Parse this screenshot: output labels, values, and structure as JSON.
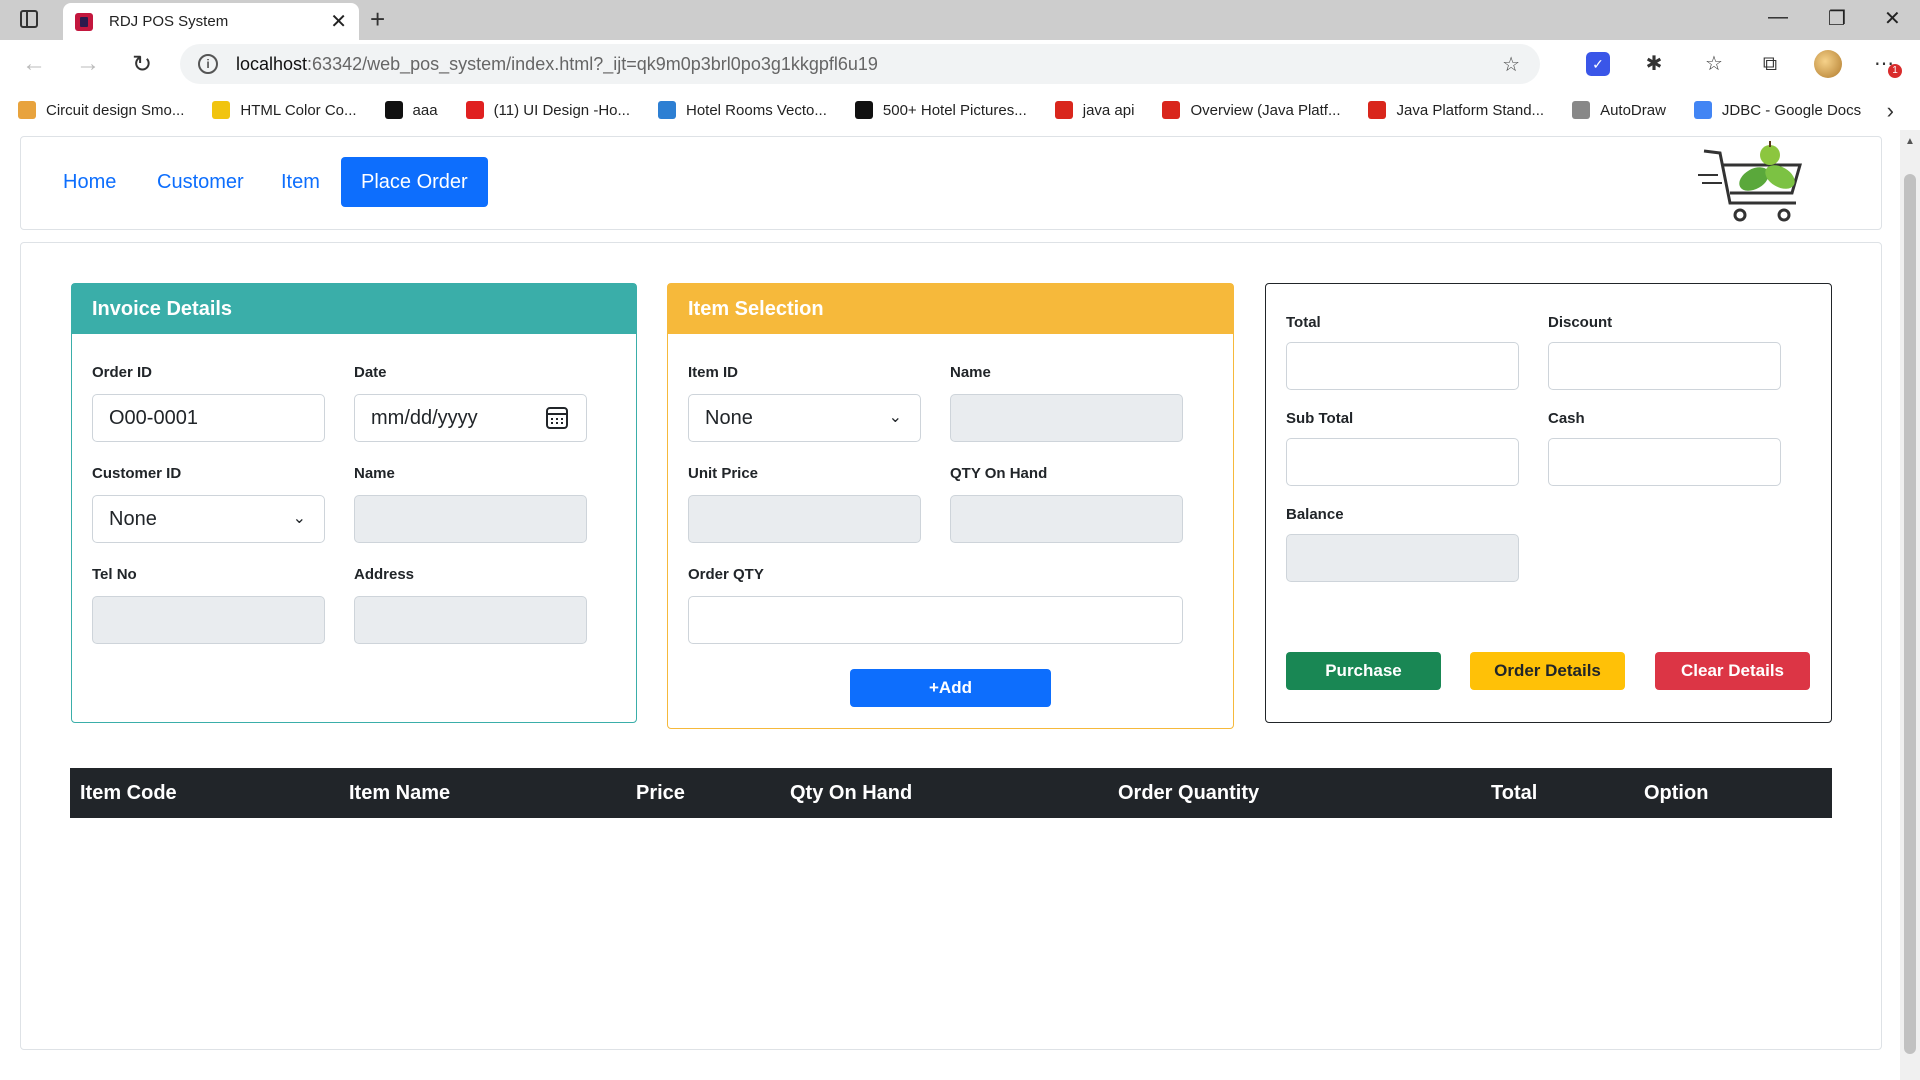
{
  "browser": {
    "tab_title": "RDJ POS System",
    "url_host": "localhost",
    "url_rest": ":63342/web_pos_system/index.html?_ijt=qk9m0p3brl0po3g1kkgpfl6u19",
    "bookmarks": [
      {
        "label": "Circuit design Smo...",
        "color": "#e8a33d"
      },
      {
        "label": "HTML Color Co...",
        "color": "#f1c40f"
      },
      {
        "label": "aaa",
        "color": "#111111"
      },
      {
        "label": "(11) UI Design -Ho...",
        "color": "#e02020"
      },
      {
        "label": "Hotel Rooms Vecto...",
        "color": "#2d7fd3"
      },
      {
        "label": "500+ Hotel Pictures...",
        "color": "#111111"
      },
      {
        "label": "java api",
        "color": "#d9261c"
      },
      {
        "label": "Overview (Java Platf...",
        "color": "#d9261c"
      },
      {
        "label": "Java Platform Stand...",
        "color": "#d9261c"
      },
      {
        "label": "AutoDraw",
        "color": "#888888"
      },
      {
        "label": "JDBC - Google Docs",
        "color": "#4285f4"
      }
    ]
  },
  "nav": {
    "home": "Home",
    "customer": "Customer",
    "item": "Item",
    "place_order": "Place Order"
  },
  "invoice": {
    "title": "Invoice Details",
    "order_id_label": "Order ID",
    "order_id_value": "O00-0001",
    "date_label": "Date",
    "date_placeholder": "mm/dd/yyyy",
    "customer_id_label": "Customer ID",
    "customer_id_value": "None",
    "name_label": "Name",
    "tel_label": "Tel No",
    "address_label": "Address"
  },
  "item_selection": {
    "title": "Item Selection",
    "item_id_label": "Item ID",
    "item_id_value": "None",
    "name_label": "Name",
    "unit_price_label": "Unit Price",
    "qty_on_hand_label": "QTY On Hand",
    "order_qty_label": "Order QTY",
    "add_button": "+Add"
  },
  "totals": {
    "total_label": "Total",
    "discount_label": "Discount",
    "sub_total_label": "Sub Total",
    "cash_label": "Cash",
    "balance_label": "Balance",
    "purchase_button": "Purchase",
    "order_details_button": "Order Details",
    "clear_details_button": "Clear Details"
  },
  "table": {
    "headers": [
      "Item Code",
      "Item Name",
      "Price",
      "Qty On Hand",
      "Order Quantity",
      "Total",
      "Option"
    ]
  },
  "colors": {
    "invoice_header": "#3aaea9",
    "item_header": "#f6b93b",
    "primary": "#0d6efd",
    "success": "#198754",
    "warning": "#ffc107",
    "danger": "#dc3545",
    "dark": "#212529"
  }
}
